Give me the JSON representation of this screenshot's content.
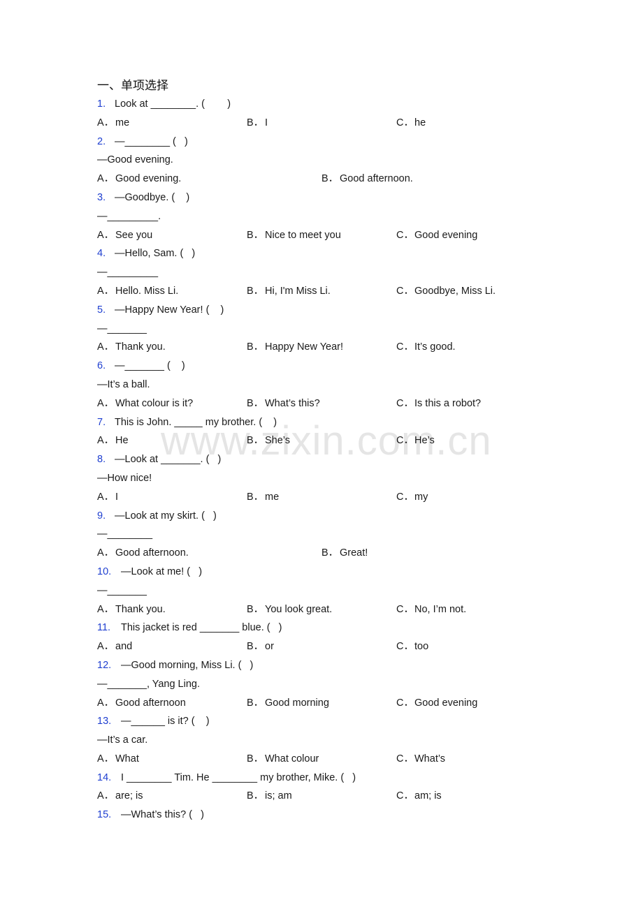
{
  "section_title": "一、单项选择",
  "watermark": "www.zixin.com.cn",
  "colors": {
    "question_number": "#1f3fd0",
    "text": "#1a1a1a"
  },
  "questions": [
    {
      "num": "1.",
      "stem": "Look at ________. (        )",
      "lines": [],
      "options": [
        [
          "A．",
          "me"
        ],
        [
          "B．",
          "I"
        ],
        [
          "C．",
          "he"
        ]
      ]
    },
    {
      "num": "2.",
      "stem": "—________ (   )",
      "lines": [
        "—Good evening."
      ],
      "options": [
        [
          "A．",
          "Good evening."
        ],
        [
          "B．",
          "Good afternoon."
        ]
      ]
    },
    {
      "num": "3.",
      "stem": "—Goodbye. (    )",
      "lines": [
        "—_________."
      ],
      "options": [
        [
          "A．",
          "See you"
        ],
        [
          "B．",
          "Nice to meet you"
        ],
        [
          "C．",
          "Good evening"
        ]
      ]
    },
    {
      "num": "4.",
      "stem": "—Hello, Sam. (   )",
      "lines": [
        "—_________"
      ],
      "options": [
        [
          "A．",
          "Hello. Miss Li."
        ],
        [
          "B．",
          "Hi, I'm Miss Li."
        ],
        [
          "C．",
          "Goodbye, Miss Li."
        ]
      ]
    },
    {
      "num": "5.",
      "stem": "—Happy New Year! (    )",
      "lines": [
        "—_______"
      ],
      "options": [
        [
          "A．",
          "Thank you."
        ],
        [
          "B．",
          "Happy New Year!"
        ],
        [
          "C．",
          "It’s good."
        ]
      ]
    },
    {
      "num": "6.",
      "stem": "—_______ (    )",
      "lines": [
        "—It’s a ball."
      ],
      "options": [
        [
          "A．",
          "What colour is it?"
        ],
        [
          "B．",
          "What’s this?"
        ],
        [
          "C．",
          "Is this a robot?"
        ]
      ]
    },
    {
      "num": "7.",
      "stem": "This is John. _____ my brother. (    )",
      "lines": [],
      "options": [
        [
          "A．",
          "He"
        ],
        [
          "B．",
          "She’s"
        ],
        [
          "C．",
          "He’s"
        ]
      ]
    },
    {
      "num": "8.",
      "stem": "—Look at _______. (   )",
      "lines": [
        "—How nice!"
      ],
      "options": [
        [
          "A．",
          "I"
        ],
        [
          "B．",
          "me"
        ],
        [
          "C．",
          "my"
        ]
      ]
    },
    {
      "num": "9.",
      "stem": "—Look at my skirt. (   )",
      "lines": [
        "—________"
      ],
      "options": [
        [
          "A．",
          "Good afternoon."
        ],
        [
          "B．",
          "Great!"
        ]
      ]
    },
    {
      "num": "10.",
      "stem": "—Look at me! (   )",
      "lines": [
        "—_______"
      ],
      "options": [
        [
          "A．",
          "Thank you."
        ],
        [
          "B．",
          "You look great."
        ],
        [
          "C．",
          "No, I’m not."
        ]
      ]
    },
    {
      "num": "11.",
      "stem": "This jacket is red _______ blue. (   )",
      "lines": [],
      "options": [
        [
          "A．",
          "and"
        ],
        [
          "B．",
          "or"
        ],
        [
          "C．",
          "too"
        ]
      ]
    },
    {
      "num": "12.",
      "stem": "—Good morning, Miss Li. (   )",
      "lines": [
        "—_______, Yang Ling."
      ],
      "options": [
        [
          "A．",
          "Good afternoon"
        ],
        [
          "B．",
          "Good morning"
        ],
        [
          "C．",
          "Good evening"
        ]
      ]
    },
    {
      "num": "13.",
      "stem": "—______ is it? (    )",
      "lines": [
        "—It’s a car."
      ],
      "options": [
        [
          "A．",
          "What"
        ],
        [
          "B．",
          "What colour"
        ],
        [
          "C．",
          "What’s"
        ]
      ]
    },
    {
      "num": "14.",
      "stem": "I ________ Tim. He ________ my brother, Mike. (   )",
      "lines": [],
      "options": [
        [
          "A．",
          "are; is"
        ],
        [
          "B．",
          "is; am"
        ],
        [
          "C．",
          "am; is"
        ]
      ]
    },
    {
      "num": "15.",
      "stem": "—What’s this? (   )",
      "lines": [],
      "options": []
    }
  ]
}
